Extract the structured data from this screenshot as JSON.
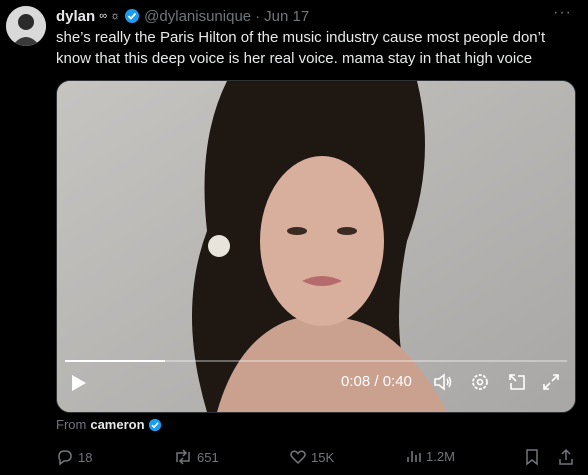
{
  "user": {
    "name": "dylan",
    "emoji": "∞ ☼",
    "handle": "@dylanisunique",
    "date": "Jun 17"
  },
  "tweet_text": "she’s really the Paris Hilton of the music industry cause most people don’t know that this deep voice is her real voice. mama stay in that high voice",
  "video": {
    "time": "0:08 / 0:40",
    "progress": 0.2
  },
  "from": {
    "label": "From",
    "user": "cameron"
  },
  "actions": {
    "replies": "18",
    "reposts": "651",
    "likes": "15K",
    "views": "1.2M"
  },
  "more_label": "···",
  "colors": {
    "verified": "#1d9bf0",
    "muted": "#71767b"
  }
}
